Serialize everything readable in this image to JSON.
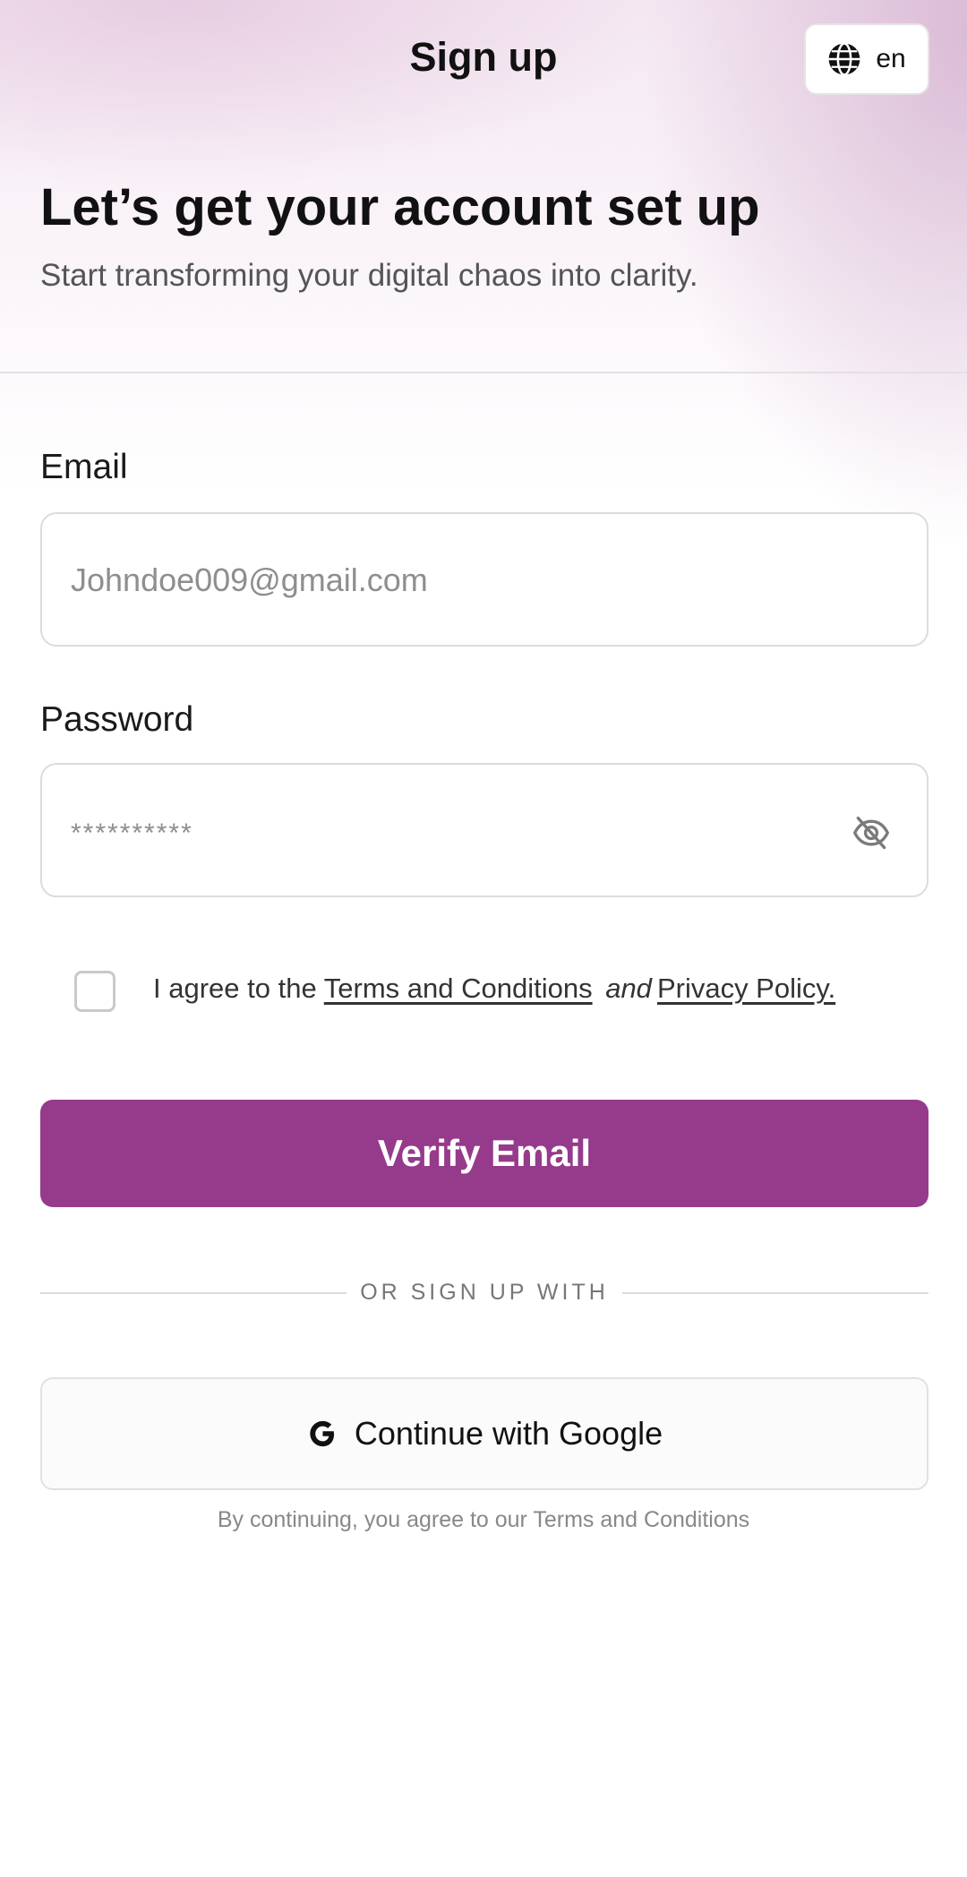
{
  "header": {
    "title": "Sign up",
    "language": "en"
  },
  "intro": {
    "title": "Let’s get your account set up",
    "subtitle": "Start transforming your digital chaos into clarity."
  },
  "form": {
    "email_label": "Email",
    "email_placeholder": "Johndoe009@gmail.com",
    "password_label": "Password",
    "password_placeholder": "**********",
    "agree_prefix": "I agree to the",
    "terms_link": "Terms and Conditions",
    "agree_and": "and",
    "privacy_link": "Privacy Policy.",
    "checkbox_checked": false,
    "verify_button": "Verify Email"
  },
  "alt_signup": {
    "divider_text": "OR SIGN UP WITH",
    "google_button": "Continue with Google",
    "footer_note": "By continuing, you agree to our Terms and Conditions"
  },
  "colors": {
    "primary": "#963a8c",
    "background_tint": "#ecd6e8"
  },
  "icons": {
    "language": "globe-icon",
    "password_toggle": "eye-off-icon",
    "google": "google-icon"
  }
}
